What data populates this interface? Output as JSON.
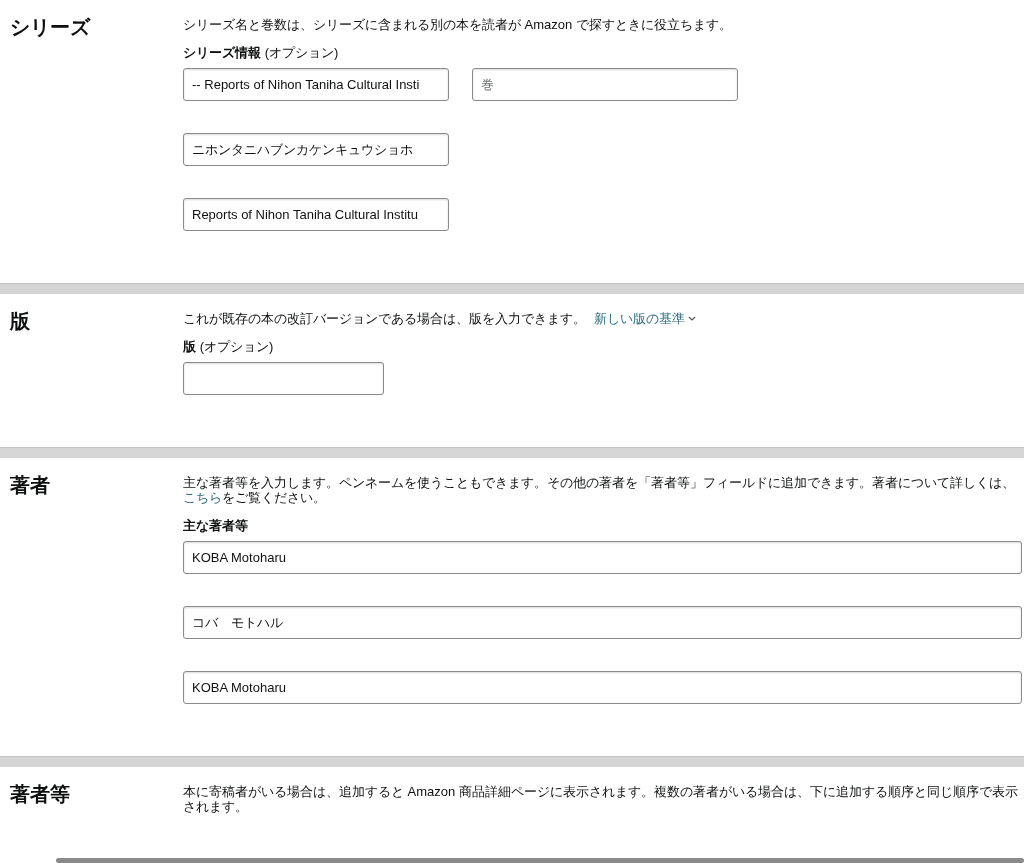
{
  "sections": [
    {
      "kind": "series",
      "title": "シリーズ",
      "description": {
        "text": "シリーズ名と巻数は、シリーズに含まれる別の本を読者が Amazon で探すときに役立ちます。"
      },
      "field_label": {
        "bold": "シリーズ情報",
        "note": "(オプション)"
      },
      "rows": [
        {
          "fields": [
            {
              "kind": "text",
              "value": "-- Reports of Nihon Taniha Cultural Insti"
            },
            {
              "kind": "text",
              "placeholder": "巻"
            }
          ]
        },
        {
          "fields": [
            {
              "kind": "text",
              "value": "ニホンタニハブンカケンキュウショホ"
            }
          ]
        },
        {
          "fields": [
            {
              "kind": "text",
              "value": "Reports of Nihon Taniha Cultural Institu"
            }
          ]
        }
      ]
    },
    {
      "kind": "edition",
      "title": "版",
      "description": {
        "text": "これが既存の本の改訂バージョンである場合は、版を入力できます。",
        "link": "新しい版の基準",
        "expandable": true
      },
      "field_label": {
        "bold": "版",
        "note": "(オプション)"
      },
      "rows": [
        {
          "fields": [
            {
              "kind": "text"
            }
          ]
        }
      ]
    },
    {
      "kind": "author",
      "title": "著者",
      "description": {
        "text": "主な著者等を入力します。ペンネームを使うこともできます。その他の著者を「著者等」フィールドに追加できます。著者について詳しくは、",
        "link": "こちら",
        "after": "をご覧ください。"
      },
      "field_label": {
        "bold": "主な著者等"
      },
      "rows": [
        {
          "fields": [
            {
              "kind": "text",
              "value": "KOBA Motoharu"
            }
          ]
        },
        {
          "fields": [
            {
              "kind": "text",
              "value": "コバ　モトハル"
            }
          ]
        },
        {
          "fields": [
            {
              "kind": "text",
              "value": "KOBA Motoharu"
            }
          ]
        }
      ]
    },
    {
      "kind": "text",
      "title": "著者等",
      "description": {
        "text": "本に寄稿者がいる場合は、追加すると Amazon 商品詳細ページに表示されます。複数の著者がいる場合は、下に追加する順序と同じ順序で表示されます。"
      }
    }
  ]
}
